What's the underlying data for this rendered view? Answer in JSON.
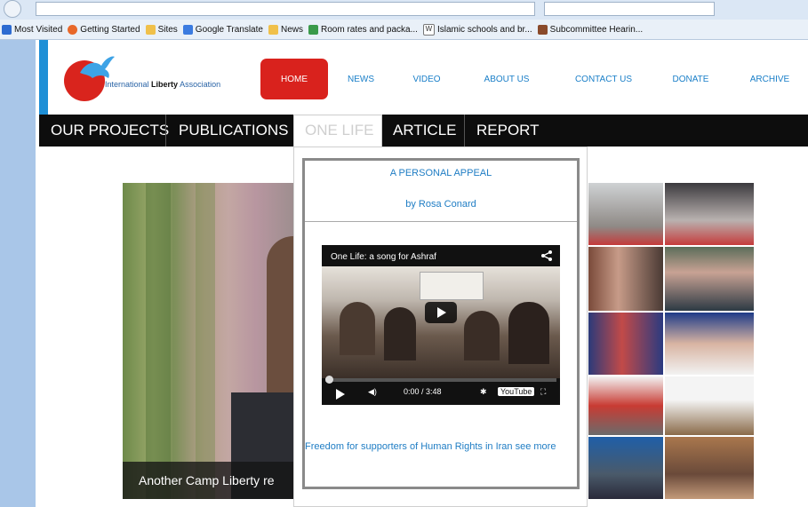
{
  "bookmarks": [
    {
      "label": "Most Visited",
      "icon": "star-icon",
      "color": "#2d6bd1"
    },
    {
      "label": "Getting Started",
      "icon": "firefox-icon",
      "color": "#e8682a"
    },
    {
      "label": "Sites",
      "icon": "folder-icon",
      "color": "#f0c04a"
    },
    {
      "label": "Google Translate",
      "icon": "translate-icon",
      "color": "#3b7be0"
    },
    {
      "label": "News",
      "icon": "folder-icon",
      "color": "#f0c04a"
    },
    {
      "label": "Room rates and packa...",
      "icon": "hotel-icon",
      "color": "#3a9a4a"
    },
    {
      "label": "Islamic schools and br...",
      "icon": "wikipedia-icon",
      "color": "#777777"
    },
    {
      "label": "Subcommittee Hearin...",
      "icon": "congress-icon",
      "color": "#8a4a2a"
    }
  ],
  "logo": {
    "prefix": "International ",
    "bold": "Liberty",
    "suffix": " Association"
  },
  "nav": {
    "items": [
      "HOME",
      "NEWS",
      "VIDEO",
      "ABOUT US",
      "CONTACT US",
      "DONATE",
      "ARCHIVE"
    ],
    "active": "HOME"
  },
  "subnav": {
    "items": [
      "OUR PROJECTS",
      "PUBLICATIONS",
      "ONE LIFE",
      "ARTICLE",
      "REPORT"
    ],
    "active": "ONE LIFE"
  },
  "dropdown": {
    "title": "A PERSONAL APPEAL",
    "author": "by Rosa Conard",
    "video": {
      "title": "One Life: a song for Ashraf",
      "time": "0:00 / 3:48",
      "brand": "YouTube"
    },
    "link": "Freedom for supporters of Human Rights in Iran see more"
  },
  "hero": {
    "caption": "Another Camp Liberty re"
  },
  "colors": {
    "accent_red": "#d9221d",
    "link_blue": "#1f7dc4",
    "subnav_bg": "#0d0d0d",
    "accent_bar": "#1e8fd6"
  }
}
